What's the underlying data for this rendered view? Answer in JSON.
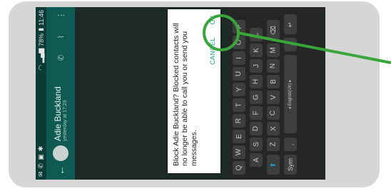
{
  "status_bar": {
    "time": "11:46",
    "battery": "78%"
  },
  "chat_header": {
    "contact_name": "Adie Buckland",
    "last_seen": "yesterday at 17:29",
    "back_icon": "back-arrow-icon",
    "attach_icon": "paperclip-icon",
    "call_icon": "phone-icon",
    "menu_icon": "overflow-menu-icon"
  },
  "dialog": {
    "message": "Block Adie Buckland? Blocked contacts will no longer be able to call you or send you messages.",
    "cancel_label": "CANCEL",
    "ok_label": "OK"
  },
  "keyboard": {
    "rows": [
      [
        "Q",
        "W",
        "E",
        "R",
        "T",
        "Y",
        "U",
        "I",
        "O",
        "P"
      ],
      [
        "A",
        "S",
        "D",
        "F",
        "G",
        "H",
        "J",
        "K",
        "L"
      ],
      [
        "Z",
        "X",
        "C",
        "V",
        "B",
        "N",
        "M"
      ]
    ],
    "shift_label": "⬆",
    "backspace_label": "⌫",
    "sym_label": "Sym",
    "mic_label": "🎤",
    "comma_label": ",",
    "space_label": "◂ English(UK) ▸",
    "period_label": ".",
    "enter_label": "↵"
  },
  "colors": {
    "accent": "#19a184",
    "annotation": "#3aa53a",
    "toolbar": "#0f5a52"
  }
}
